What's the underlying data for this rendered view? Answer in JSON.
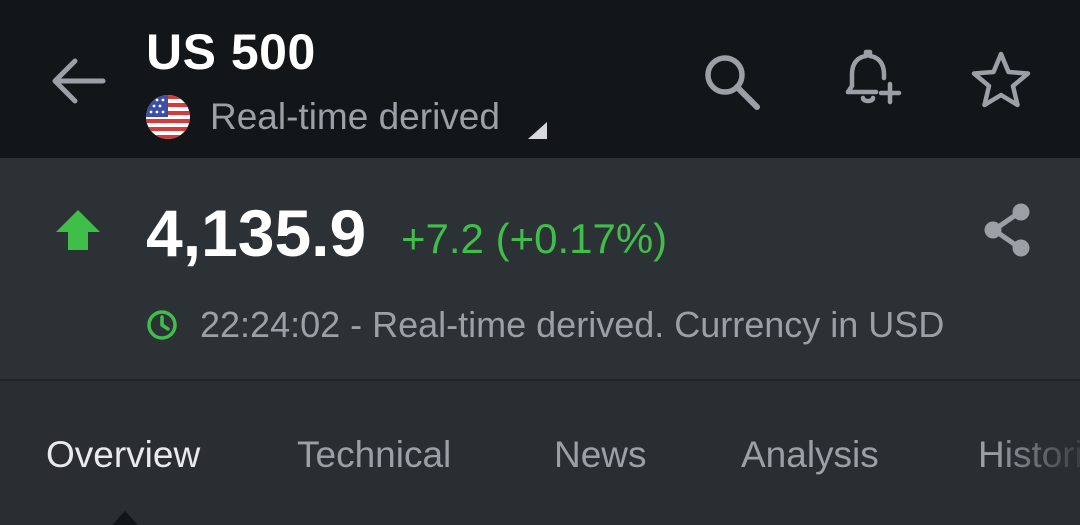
{
  "header": {
    "title": "US 500",
    "subtitle": "Real-time derived",
    "flag_icon": "us-flag-icon",
    "back_icon": "arrow-left-icon",
    "search_icon": "search-icon",
    "alert_icon": "bell-plus-icon",
    "watchlist_icon": "star-icon"
  },
  "quote": {
    "direction": "up",
    "price": "4,135.9",
    "change": "+7.2 (+0.17%)",
    "timestamp_line": "22:24:02 - Real-time derived. Currency in USD",
    "share_icon": "share-icon",
    "clock_icon": "clock-icon"
  },
  "tabs": [
    {
      "label": "Overview",
      "active": true
    },
    {
      "label": "Technical",
      "active": false
    },
    {
      "label": "News",
      "active": false
    },
    {
      "label": "Analysis",
      "active": false
    },
    {
      "label": "Historical Data",
      "active": false
    }
  ],
  "colors": {
    "header_bg": "#121619",
    "body_bg": "#2c3136",
    "positive": "#3fbe49",
    "muted_text": "#9aa0a6",
    "primary_text": "#ffffff"
  }
}
